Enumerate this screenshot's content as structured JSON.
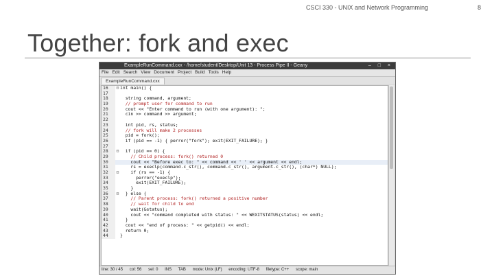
{
  "slide": {
    "course": "CSCI 330 - UNIX and Network Programming",
    "number": "8",
    "title": "Together: fork and exec"
  },
  "window": {
    "title": "ExampleRunCommand.cxx - /home/student/Desktop/Unit 13 - Process Pipe II - Geany",
    "controls": "– □ ×",
    "menu": [
      "File",
      "Edit",
      "Search",
      "View",
      "Document",
      "Project",
      "Build",
      "Tools",
      "Help"
    ],
    "tab": "ExampleRunCommand.cxx"
  },
  "editor": {
    "lines": [
      {
        "n": "16",
        "fold": "⊟",
        "text": "int main() {"
      },
      {
        "n": "17",
        "fold": "",
        "text": ""
      },
      {
        "n": "18",
        "fold": "",
        "text": "  string command, argument;"
      },
      {
        "n": "19",
        "fold": "",
        "text": "  // prompt user for command to run"
      },
      {
        "n": "20",
        "fold": "",
        "text": "  cout << \"Enter command to run (with one argument): \";"
      },
      {
        "n": "21",
        "fold": "",
        "text": "  cin >> command >> argument;"
      },
      {
        "n": "22",
        "fold": "",
        "text": ""
      },
      {
        "n": "23",
        "fold": "",
        "text": "  int pid, rs, status;"
      },
      {
        "n": "24",
        "fold": "",
        "text": "  // fork will make 2 processes"
      },
      {
        "n": "25",
        "fold": "",
        "text": "  pid = fork();"
      },
      {
        "n": "26",
        "fold": "",
        "text": "  if (pid == -1) { perror(\"fork\"); exit(EXIT_FAILURE); }"
      },
      {
        "n": "27",
        "fold": "",
        "text": ""
      },
      {
        "n": "28",
        "fold": "⊟",
        "text": "  if (pid == 0) {"
      },
      {
        "n": "29",
        "fold": "",
        "text": "    // Child process: fork() returned 0"
      },
      {
        "n": "30",
        "fold": "",
        "text": "    cout << \"Before exec to: \" << command << ' ' << argument << endl;"
      },
      {
        "n": "31",
        "fold": "",
        "text": "    rs = execlp(command.c_str(), command.c_str(), argument.c_str(), (char*) NULL);"
      },
      {
        "n": "32",
        "fold": "⊟",
        "text": "    if (rs == -1) {"
      },
      {
        "n": "33",
        "fold": "",
        "text": "      perror(\"execlp\");"
      },
      {
        "n": "34",
        "fold": "",
        "text": "      exit(EXIT_FAILURE);"
      },
      {
        "n": "35",
        "fold": "",
        "text": "    }"
      },
      {
        "n": "36",
        "fold": "⊟",
        "text": "  } else {"
      },
      {
        "n": "37",
        "fold": "",
        "text": "    // Parent process: fork() returned a positive number"
      },
      {
        "n": "38",
        "fold": "",
        "text": "    // wait for child to end"
      },
      {
        "n": "39",
        "fold": "",
        "text": "    wait(&status);"
      },
      {
        "n": "40",
        "fold": "",
        "text": "    cout << \"command completed with status: \" << WEXITSTATUS(status) << endl;"
      },
      {
        "n": "41",
        "fold": "",
        "text": "  }"
      },
      {
        "n": "42",
        "fold": "",
        "text": "  cout << \"end of process: \" << getpid() << endl;"
      },
      {
        "n": "43",
        "fold": "",
        "text": "  return 0;"
      },
      {
        "n": "44",
        "fold": "",
        "text": "}"
      }
    ],
    "current_line": "30"
  },
  "statusbar": {
    "line": "line: 30 / 45",
    "col": "col: 56",
    "sel": "sel: 0",
    "ins": "INS",
    "tab": "TAB",
    "mode": "mode: Unix (LF)",
    "encoding": "encoding: UTF-8",
    "filetype": "filetype: C++",
    "scope": "scope: main"
  },
  "colors": {
    "comment": "#b02020",
    "string": "#c03a3a",
    "keyword": "#1a1a8c",
    "current_line": "#e8eef7"
  }
}
